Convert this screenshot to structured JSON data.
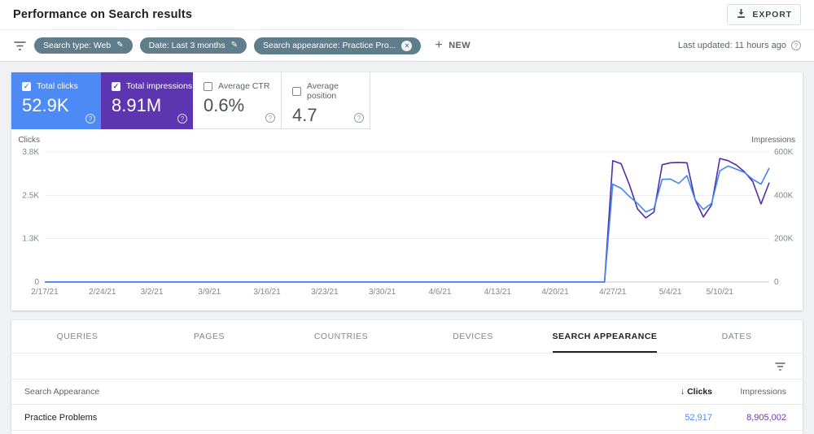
{
  "header": {
    "title": "Performance on Search results",
    "export_label": "EXPORT"
  },
  "filters": {
    "chips": [
      {
        "label": "Search type: Web",
        "icon": "edit-icon"
      },
      {
        "label": "Date: Last 3 months",
        "icon": "edit-icon"
      },
      {
        "label": "Search appearance: Practice Pro...",
        "icon": "remove-icon"
      }
    ],
    "new_label": "NEW",
    "last_updated": "Last updated: 11 hours ago"
  },
  "icons": {
    "edit": "✎",
    "remove": "×",
    "plus": "+",
    "check": "✓",
    "sort_desc": "↓",
    "help": "?"
  },
  "metrics": [
    {
      "label": "Total clicks",
      "value": "52.9K",
      "selected": true
    },
    {
      "label": "Total impressions",
      "value": "8.91M",
      "selected": true
    },
    {
      "label": "Average CTR",
      "value": "0.6%",
      "selected": false
    },
    {
      "label": "Average position",
      "value": "4.7",
      "selected": false
    }
  ],
  "colors": {
    "chip_bg": "#607d8b",
    "clicks_card": "#4d8af5",
    "impressions_card": "#5e35b1",
    "clicks_line": "#4285f4",
    "impressions_line": "#512da8",
    "table_clicks_value": "#4d8af5",
    "table_impressions_value": "#7337b6"
  },
  "chart_data": {
    "type": "line",
    "days_total": 88,
    "grid": true,
    "legend_position": "none",
    "x_axis": {
      "start_date": "2/17/21",
      "end_date": "5/16/21",
      "ticks": [
        {
          "label": "2/17/21",
          "day": 0
        },
        {
          "label": "2/24/21",
          "day": 7
        },
        {
          "label": "3/2/21",
          "day": 13
        },
        {
          "label": "3/9/21",
          "day": 20
        },
        {
          "label": "3/16/21",
          "day": 27
        },
        {
          "label": "3/23/21",
          "day": 34
        },
        {
          "label": "3/30/21",
          "day": 41
        },
        {
          "label": "4/6/21",
          "day": 48
        },
        {
          "label": "4/13/21",
          "day": 55
        },
        {
          "label": "4/20/21",
          "day": 62
        },
        {
          "label": "4/27/21",
          "day": 69
        },
        {
          "label": "5/4/21",
          "day": 76
        },
        {
          "label": "5/10/21",
          "day": 82
        }
      ]
    },
    "y_left": {
      "label": "Clicks",
      "max": 3800,
      "ticks": [
        "3.8K",
        "2.5K",
        "1.3K",
        "0"
      ]
    },
    "y_right": {
      "label": "Impressions",
      "max": 600000,
      "ticks": [
        "600K",
        "400K",
        "200K",
        "0"
      ]
    },
    "series": [
      {
        "name": "Clicks",
        "axis": "left",
        "color": "#4285f4",
        "points": [
          [
            0,
            0
          ],
          [
            68,
            0
          ],
          [
            69,
            2860
          ],
          [
            70,
            2740
          ],
          [
            71,
            2500
          ],
          [
            72,
            2300
          ],
          [
            73,
            2050
          ],
          [
            74,
            2150
          ],
          [
            75,
            3000
          ],
          [
            76,
            3010
          ],
          [
            77,
            2880
          ],
          [
            78,
            3110
          ],
          [
            79,
            2400
          ],
          [
            80,
            2120
          ],
          [
            81,
            2300
          ],
          [
            82,
            3250
          ],
          [
            83,
            3390
          ],
          [
            84,
            3300
          ],
          [
            85,
            3200
          ],
          [
            86,
            3000
          ],
          [
            87,
            2860
          ],
          [
            88,
            3330
          ]
        ]
      },
      {
        "name": "Impressions",
        "axis": "right",
        "color": "#512da8",
        "points": [
          [
            0,
            0
          ],
          [
            68,
            0
          ],
          [
            69,
            560000
          ],
          [
            70,
            546000
          ],
          [
            71,
            450000
          ],
          [
            72,
            337000
          ],
          [
            73,
            296000
          ],
          [
            74,
            323000
          ],
          [
            75,
            541000
          ],
          [
            76,
            550000
          ],
          [
            77,
            552000
          ],
          [
            78,
            550000
          ],
          [
            79,
            379000
          ],
          [
            80,
            300000
          ],
          [
            81,
            356000
          ],
          [
            82,
            570000
          ],
          [
            83,
            560000
          ],
          [
            84,
            540000
          ],
          [
            85,
            508000
          ],
          [
            86,
            463000
          ],
          [
            87,
            360000
          ],
          [
            88,
            459000
          ]
        ]
      }
    ]
  },
  "tabs": [
    {
      "label": "QUERIES",
      "active": false
    },
    {
      "label": "PAGES",
      "active": false
    },
    {
      "label": "COUNTRIES",
      "active": false
    },
    {
      "label": "DEVICES",
      "active": false
    },
    {
      "label": "SEARCH APPEARANCE",
      "active": true
    },
    {
      "label": "DATES",
      "active": false
    }
  ],
  "table": {
    "columns": {
      "name": "Search Appearance",
      "clicks": "Clicks",
      "impressions": "Impressions"
    },
    "sorted_by": "Clicks",
    "rows": [
      {
        "name": "Practice Problems",
        "clicks": "52,917",
        "impressions": "8,905,002"
      }
    ]
  }
}
